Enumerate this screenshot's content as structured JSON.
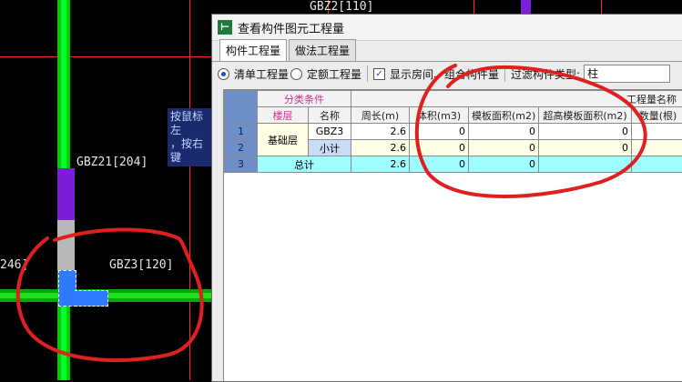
{
  "cad": {
    "labels": {
      "gbz2": "GBZ2[110]",
      "gbz21": "GBZ21[204]",
      "gbz3": "GBZ3[120]",
      "left_partial": "246]"
    },
    "hint_lines": [
      "按鼠标左",
      "，按右键"
    ],
    "colors": {
      "green": "#00cc00",
      "purple": "#7a1fd6",
      "blue": "#2e7bff",
      "grey": "#b8b8b8",
      "red": "#ff2a2a",
      "annotation": "#e0201e"
    }
  },
  "dialog": {
    "title": "查看构件图元工程量",
    "tabs": [
      {
        "label": "构件工程量",
        "active": true
      },
      {
        "label": "做法工程量",
        "active": false
      }
    ],
    "options": {
      "qingdan": "清单工程量",
      "dinge": "定额工程量",
      "show_rooms": "显示房间、组合构件量",
      "filter_label": "过滤构件类型:",
      "filter_value": "柱"
    },
    "grid": {
      "group_header_left": "分类条件",
      "group_header_right": "工程量名称",
      "columns": [
        "楼层",
        "名称",
        "周长(m)",
        "体积(m3)",
        "模板面积(m2)",
        "超高模板面积(m2)",
        "数量(根)"
      ],
      "rows": [
        {
          "idx": "1",
          "floor": "基础层",
          "name": "GBZ3",
          "perimeter": "2.6",
          "volume": "0",
          "formwork": "0",
          "high_formwork": "0",
          "count": ""
        },
        {
          "idx": "2",
          "floor": "",
          "name": "小计",
          "perimeter": "2.6",
          "volume": "0",
          "formwork": "0",
          "high_formwork": "0",
          "count": ""
        },
        {
          "idx": "3",
          "floor": "",
          "name": "总计",
          "perimeter": "2.6",
          "volume": "0",
          "formwork": "0",
          "high_formwork": "",
          "count": ""
        }
      ]
    }
  }
}
